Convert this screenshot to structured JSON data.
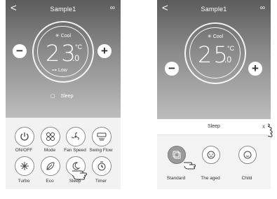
{
  "left": {
    "title": "Sample1",
    "back": "<",
    "more": "∞",
    "mode": "Cool",
    "temp": "23",
    "decimal": ".0",
    "unit": "°C",
    "fan": "Low",
    "minus": "−",
    "plus": "+",
    "sleep_label": "Sleep",
    "controls": [
      {
        "label": "ON/OFF",
        "icon": "power-icon"
      },
      {
        "label": "Mode",
        "icon": "mode-icon"
      },
      {
        "label": "Fan Speed",
        "icon": "fan-speed-icon"
      },
      {
        "label": "Swing Flow",
        "icon": "swing-icon"
      },
      {
        "label": "Turbo",
        "icon": "turbo-icon"
      },
      {
        "label": "Eco",
        "icon": "eco-icon"
      },
      {
        "label": "Sleep",
        "icon": "sleep-icon"
      },
      {
        "label": "Timer",
        "icon": "timer-icon"
      }
    ]
  },
  "right": {
    "title": "Sample1",
    "back": "<",
    "more": "∞",
    "mode": "Cool",
    "temp": "25",
    "decimal": ".0",
    "unit": "°C",
    "minus": "−",
    "plus": "+",
    "sleep_panel": {
      "title": "Sleep",
      "close": "x",
      "options": [
        {
          "label": "Standard",
          "selected": true
        },
        {
          "label": "The aged",
          "selected": false
        },
        {
          "label": "Child",
          "selected": false
        }
      ]
    }
  }
}
